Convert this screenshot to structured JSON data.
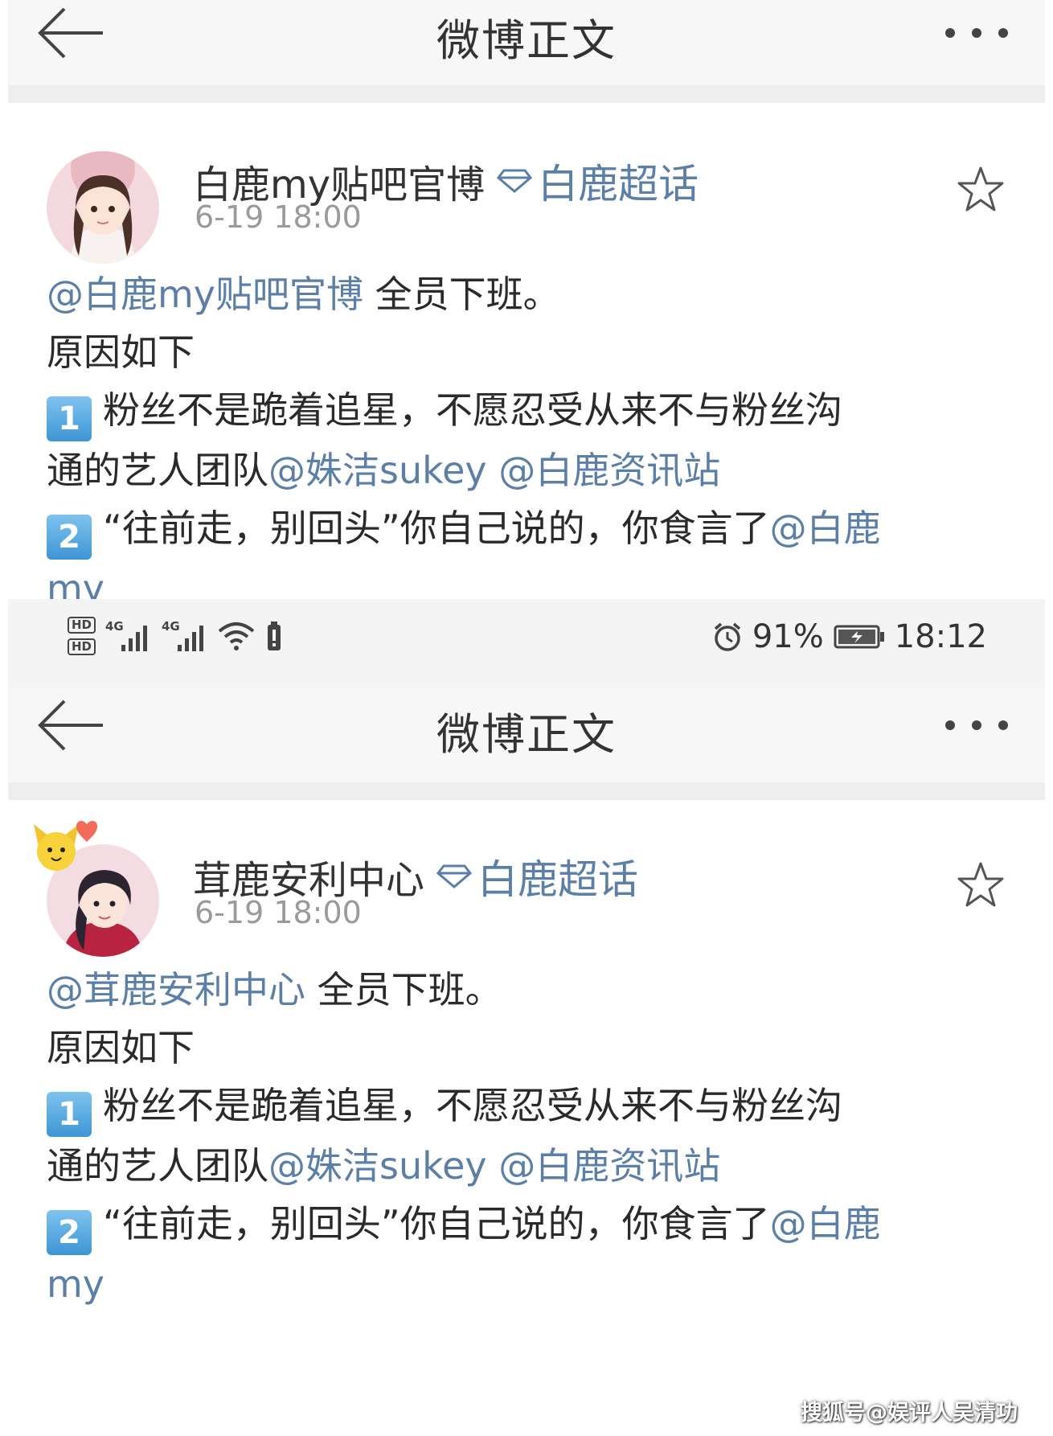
{
  "screens": [
    {
      "nav": {
        "title": "微博正文"
      },
      "post": {
        "username": "白鹿my贴吧官博",
        "topic": "白鹿超话",
        "timestamp": "6-19 18:00",
        "line1": {
          "mention": "@白鹿my贴吧官博",
          "text": " 全员下班。"
        },
        "line2": "原因如下",
        "line3": {
          "badge": "1",
          "text": "粉丝不是跪着追星，不愿忍受从来不与粉丝沟"
        },
        "line4": {
          "text": "通的艺人团队",
          "mention1": "@姝洁sukey",
          "mention2": "@白鹿资讯站"
        },
        "line5": {
          "badge": "2",
          "text": "“往前走，别回头”你自己说的，你食言了",
          "mention": "@白鹿"
        },
        "line6": {
          "mention": "my"
        }
      }
    },
    {
      "nav": {
        "title": "微博正文"
      },
      "post": {
        "username": "茸鹿安利中心",
        "topic": "白鹿超话",
        "timestamp": "6-19 18:00",
        "line1": {
          "mention": "@茸鹿安利中心",
          "text": " 全员下班。"
        },
        "line2": "原因如下",
        "line3": {
          "badge": "1",
          "text": "粉丝不是跪着追星，不愿忍受从来不与粉丝沟"
        },
        "line4": {
          "text": "通的艺人团队",
          "mention1": "@姝洁sukey",
          "mention2": "@白鹿资讯站"
        },
        "line5": {
          "badge": "2",
          "text": "“往前走，别回头”你自己说的，你食言了",
          "mention": "@白鹿"
        },
        "line6": {
          "mention": "my"
        }
      }
    }
  ],
  "statusbar": {
    "hd1": "HD",
    "hd2": "HD",
    "net1": "4G",
    "net2": "4G",
    "battery_percent": "91%",
    "time": "18:12"
  },
  "watermark": "搜狐号@娱评人吴清功",
  "colors": {
    "link": "#5b7fa6",
    "badge": "#3d95d4",
    "nav_bg": "#f7f7f7"
  }
}
